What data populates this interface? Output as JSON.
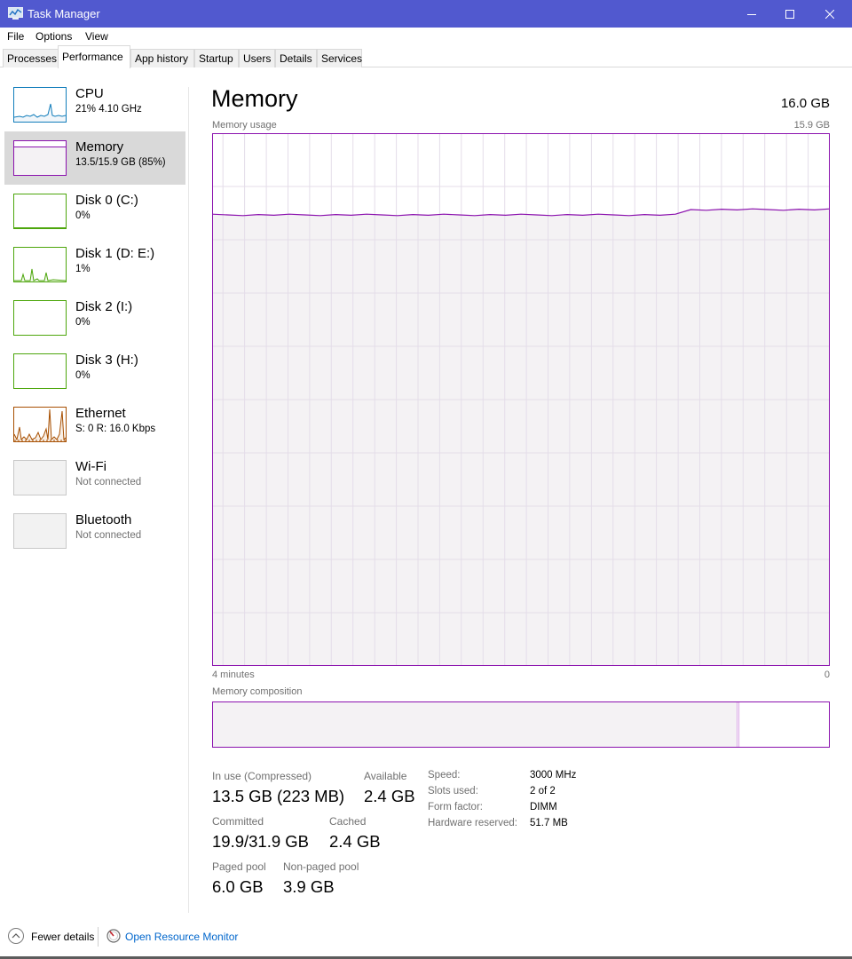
{
  "window": {
    "title": "Task Manager"
  },
  "menu": [
    "File",
    "Options",
    "View"
  ],
  "tabs": [
    "Processes",
    "Performance",
    "App history",
    "Startup",
    "Users",
    "Details",
    "Services"
  ],
  "active_tab": "Performance",
  "colors": {
    "titlebar": "#5159cf",
    "memory": "#8b12ae",
    "memory_fill": "#f4f2f4",
    "cpu": "#117dbb",
    "disk": "#4da60c",
    "ethernet": "#a74f01",
    "selected_bg": "#d9d9d9",
    "link": "#0066cc"
  },
  "sidebar": {
    "items": [
      {
        "name": "CPU",
        "sub": "21%  4.10 GHz",
        "icon": "cpu-graph"
      },
      {
        "name": "Memory",
        "sub": "13.5/15.9 GB (85%)",
        "icon": "memory-graph",
        "selected": true
      },
      {
        "name": "Disk 0 (C:)",
        "sub": "0%",
        "icon": "disk-graph"
      },
      {
        "name": "Disk 1 (D: E:)",
        "sub": "1%",
        "icon": "disk-graph"
      },
      {
        "name": "Disk 2 (I:)",
        "sub": "0%",
        "icon": "disk-graph"
      },
      {
        "name": "Disk 3 (H:)",
        "sub": "0%",
        "icon": "disk-graph"
      },
      {
        "name": "Ethernet",
        "sub": "S: 0  R: 16.0 Kbps",
        "icon": "ethernet-graph"
      },
      {
        "name": "Wi-Fi",
        "sub": "Not connected",
        "icon": "wifi-graph"
      },
      {
        "name": "Bluetooth",
        "sub": "Not connected",
        "icon": "bluetooth-graph"
      }
    ]
  },
  "main": {
    "title": "Memory",
    "total": "16.0 GB",
    "usage_label": "Memory usage",
    "usage_max": "15.9 GB",
    "time_left": "4 minutes",
    "time_right": "0",
    "composition_label": "Memory composition",
    "composition_in_use_fraction": 0.85,
    "usage_level_fraction": 0.85,
    "stats": {
      "in_use_label": "In use (Compressed)",
      "in_use_value": "13.5 GB (223 MB)",
      "available_label": "Available",
      "available_value": "2.4 GB",
      "committed_label": "Committed",
      "committed_value": "19.9/31.9 GB",
      "cached_label": "Cached",
      "cached_value": "2.4 GB",
      "paged_label": "Paged pool",
      "paged_value": "6.0 GB",
      "nonpaged_label": "Non-paged pool",
      "nonpaged_value": "3.9 GB"
    },
    "details": [
      {
        "key": "Speed:",
        "value": "3000 MHz"
      },
      {
        "key": "Slots used:",
        "value": "2 of 2"
      },
      {
        "key": "Form factor:",
        "value": "DIMM"
      },
      {
        "key": "Hardware reserved:",
        "value": "51.7 MB"
      }
    ]
  },
  "footer": {
    "fewer_details": "Fewer details",
    "resource_monitor": "Open Resource Monitor"
  }
}
